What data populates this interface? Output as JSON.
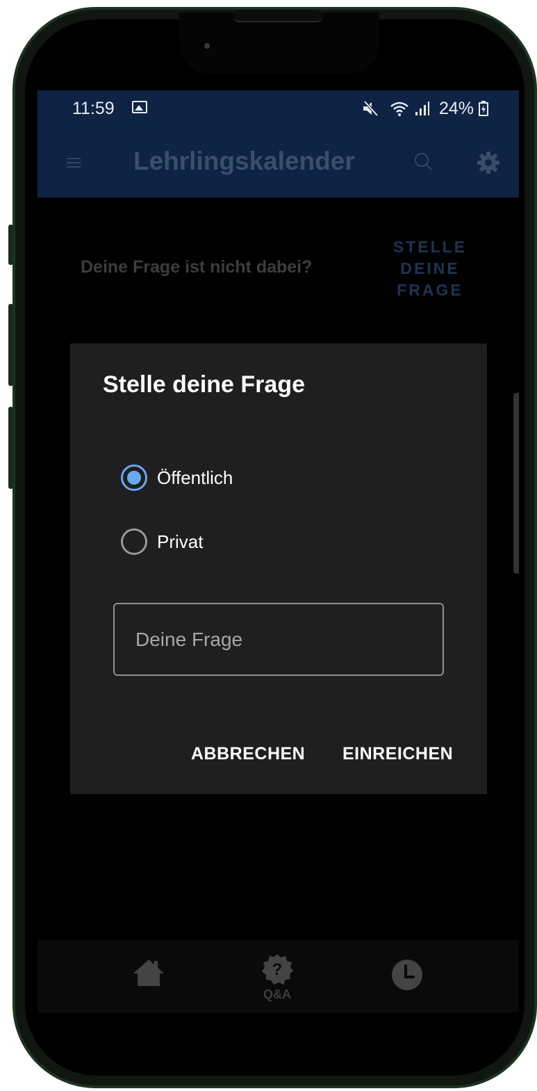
{
  "status_bar": {
    "time": "11:59",
    "battery": "24%",
    "icons": [
      "gallery-icon",
      "mute-icon",
      "wifi-icon",
      "signal-icon",
      "battery-charging-icon"
    ]
  },
  "app_bar": {
    "title": "Lehrlingskalender",
    "icons": [
      "menu-icon",
      "search-icon",
      "gear-icon"
    ]
  },
  "page": {
    "hint": "Deine Frage ist nicht dabei?",
    "cta_lines": [
      "STELLE",
      "DEINE",
      "FRAGE"
    ]
  },
  "dialog": {
    "title": "Stelle deine Frage",
    "options": [
      {
        "label": "Öffentlich",
        "checked": true
      },
      {
        "label": "Privat",
        "checked": false
      }
    ],
    "field": {
      "placeholder": "Deine Frage",
      "value": ""
    },
    "cancel_label": "ABBRECHEN",
    "submit_label": "EINREICHEN"
  },
  "bottom_nav": {
    "items": [
      {
        "icon": "home-icon",
        "label": ""
      },
      {
        "icon": "question-badge-icon",
        "label": "Q&A"
      },
      {
        "icon": "clock-icon",
        "label": ""
      }
    ]
  },
  "colors": {
    "app_bar_bg": "#0f2444",
    "accent": "#6ba8f0",
    "dialog_bg": "#1f1f1f"
  }
}
